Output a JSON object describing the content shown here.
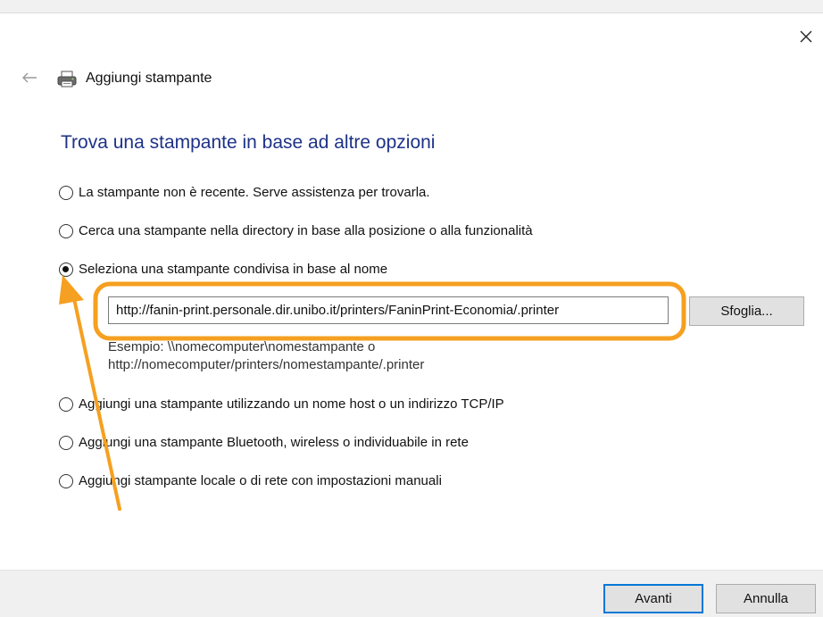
{
  "window": {
    "title": "Aggiungi stampante"
  },
  "heading": "Trova una stampante in base ad altre opzioni",
  "options": [
    {
      "label": "La stampante non è recente. Serve assistenza per trovarla.",
      "selected": false
    },
    {
      "label": "Cerca una stampante nella directory in base alla posizione o alla funzionalità",
      "selected": false
    },
    {
      "label": "Seleziona una stampante condivisa in base al nome",
      "selected": true
    },
    {
      "label": "Aggiungi una stampante utilizzando un nome host o un indirizzo TCP/IP",
      "selected": false
    },
    {
      "label": "Aggiungi una stampante Bluetooth, wireless o individuabile in rete",
      "selected": false
    },
    {
      "label": "Aggiungi stampante locale o di rete con impostazioni manuali",
      "selected": false
    }
  ],
  "shared_printer": {
    "value": "http://fanin-print.personale.dir.unibo.it/printers/FaninPrint-Economia/.printer",
    "browse_label": "Sfoglia...",
    "example_line1": "Esempio: \\\\nomecomputer\\nomestampante o",
    "example_line2": "http://nomecomputer/printers/nomestampante/.printer"
  },
  "footer": {
    "next_label": "Avanti",
    "cancel_label": "Annulla"
  },
  "icons": {
    "close": "close-icon",
    "back": "back-arrow-icon",
    "printer": "printer-icon"
  },
  "colors": {
    "heading": "#1e3287",
    "annotation": "#f5a020",
    "focus_border": "#0078d7"
  }
}
